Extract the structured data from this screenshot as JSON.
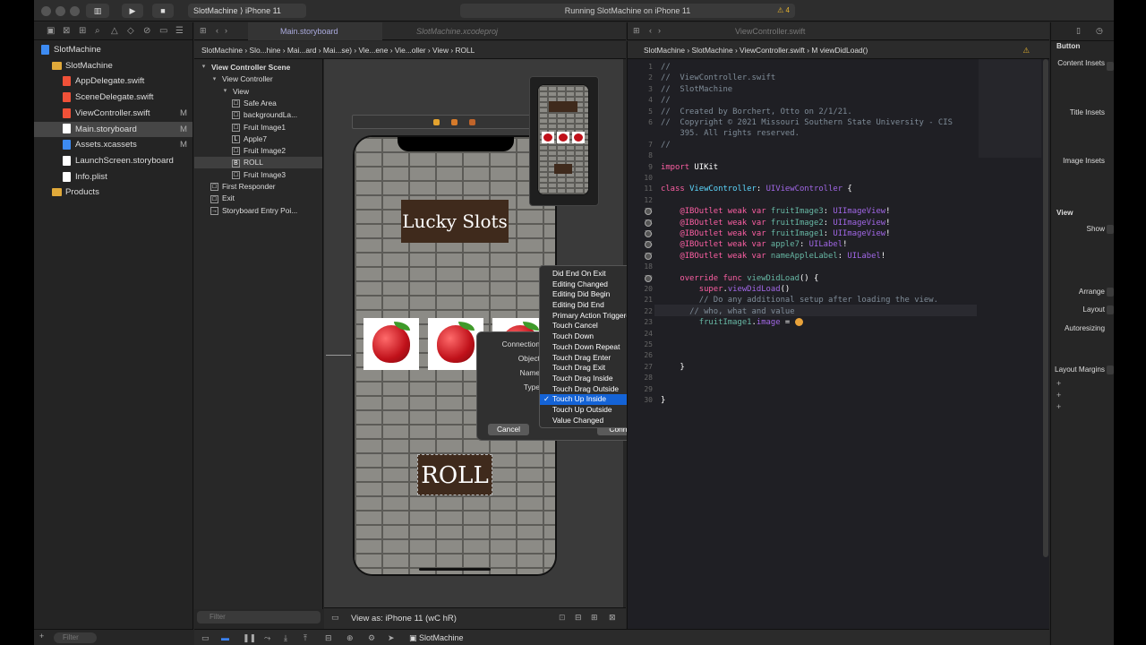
{
  "toolbar": {
    "scheme": "SlotMachine",
    "device": "iPhone 11",
    "status": "Running SlotMachine on iPhone 11",
    "warnings": "4"
  },
  "navigator": {
    "items": [
      {
        "label": "SlotMachine",
        "kind": "proj",
        "indent": 0,
        "tag": ""
      },
      {
        "label": "SlotMachine",
        "kind": "folder",
        "indent": 1,
        "tag": ""
      },
      {
        "label": "AppDelegate.swift",
        "kind": "swift",
        "indent": 2,
        "tag": ""
      },
      {
        "label": "SceneDelegate.swift",
        "kind": "swift",
        "indent": 2,
        "tag": ""
      },
      {
        "label": "ViewController.swift",
        "kind": "swift",
        "indent": 2,
        "tag": "M"
      },
      {
        "label": "Main.storyboard",
        "kind": "file",
        "indent": 2,
        "tag": "M"
      },
      {
        "label": "Assets.xcassets",
        "kind": "proj",
        "indent": 2,
        "tag": "M"
      },
      {
        "label": "LaunchScreen.storyboard",
        "kind": "file",
        "indent": 2,
        "tag": ""
      },
      {
        "label": "Info.plist",
        "kind": "file",
        "indent": 2,
        "tag": ""
      },
      {
        "label": "Products",
        "kind": "folder",
        "indent": 1,
        "tag": ""
      }
    ],
    "filter": "Filter"
  },
  "ibtabs": {
    "tab1": "Main.storyboard",
    "tab2": "SlotMachine.xcodeproj"
  },
  "ibjump": "SlotMachine  ›  Slo...hine  ›  Mai...ard  ›  Mai...se)  ›  Vie...ene  ›  Vie...oller  ›  View  ›  ROLL",
  "outline": {
    "items": [
      {
        "label": "View Controller Scene",
        "indent": 0,
        "icon": "▾"
      },
      {
        "label": "View Controller",
        "indent": 1,
        "icon": "▾"
      },
      {
        "label": "View",
        "indent": 2,
        "icon": "▾"
      },
      {
        "label": "Safe Area",
        "indent": 3,
        "icon": "□"
      },
      {
        "label": "backgroundLa...",
        "indent": 3,
        "icon": "□"
      },
      {
        "label": "Fruit Image1",
        "indent": 3,
        "icon": "□"
      },
      {
        "label": "Apple7",
        "indent": 3,
        "icon": "L"
      },
      {
        "label": "Fruit Image2",
        "indent": 3,
        "icon": "□"
      },
      {
        "label": "ROLL",
        "indent": 3,
        "icon": "B"
      },
      {
        "label": "Fruit Image3",
        "indent": 3,
        "icon": "□"
      },
      {
        "label": "First Responder",
        "indent": 1,
        "icon": "□"
      },
      {
        "label": "Exit",
        "indent": 1,
        "icon": "□"
      },
      {
        "label": "Storyboard Entry Poi...",
        "indent": 1,
        "icon": "→"
      }
    ],
    "filter": "Filter"
  },
  "canvas": {
    "title": "Lucky Slots",
    "roll": "ROLL",
    "viewAs": "View as: iPhone 11 (wC hR)"
  },
  "connection": {
    "labels": [
      "Connection",
      "Object",
      "Name",
      "Type"
    ],
    "cancel": "Cancel",
    "connect": "Connect"
  },
  "menu": {
    "items": [
      "Did End On Exit",
      "Editing Changed",
      "Editing Did Begin",
      "Editing Did End",
      "Primary Action Triggered",
      "Touch Cancel",
      "Touch Down",
      "Touch Down Repeat",
      "Touch Drag Enter",
      "Touch Drag Exit",
      "Touch Drag Inside",
      "Touch Drag Outside",
      "Touch Up Inside",
      "Touch Up Outside",
      "Value Changed"
    ],
    "selected": "Touch Up Inside"
  },
  "editor": {
    "tab": "ViewController.swift",
    "jump": "SlotMachine  ›  SlotMachine  ›  ViewController.swift  ›  M  viewDidLoad()"
  },
  "inspector": {
    "title": "Button",
    "content_insets": "Content Insets",
    "title_insets": "Title Insets",
    "image_insets": "Image Insets",
    "view": "View",
    "show": "Show",
    "arrange": "Arrange",
    "layout": "Layout",
    "autoresizing": "Autoresizing",
    "layout_margins": "Layout Margins"
  },
  "debug": {
    "target": "SlotMachine"
  }
}
